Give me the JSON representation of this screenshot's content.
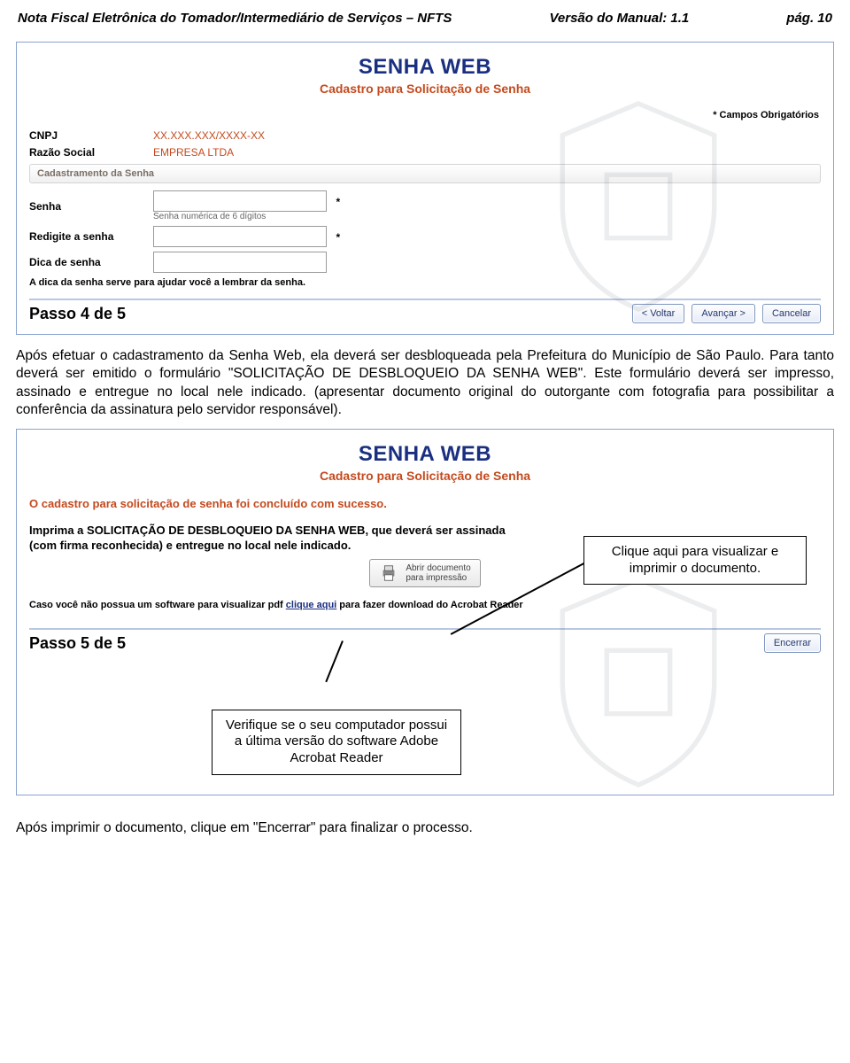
{
  "docHeader": {
    "left": "Nota Fiscal Eletrônica do Tomador/Intermediário de Serviços – NFTS",
    "center": "Versão do Manual: 1.1",
    "right": "pág. 10"
  },
  "panel1": {
    "title": "SENHA WEB",
    "subtitle": "Cadastro para Solicitação de Senha",
    "requiredNote": "* Campos Obrigatórios",
    "cnpjLabel": "CNPJ",
    "cnpjValue": "XX.XXX.XXX/XXXX-XX",
    "razaoLabel": "Razão Social",
    "razaoValue": "EMPRESA LTDA",
    "groupTitle": "Cadastramento da Senha",
    "senhaLabel": "Senha",
    "senhaHint": "Senha numérica de 6 dígitos",
    "redigiteLabel": "Redigite a senha",
    "dicaLabel": "Dica de senha",
    "dicaHelp": "A dica da senha serve para ajudar você a lembrar da senha.",
    "step": "Passo 4 de 5",
    "btnVoltar": "< Voltar",
    "btnAvancar": "Avançar >",
    "btnCancelar": "Cancelar"
  },
  "paragraph1": "Após efetuar o cadastramento da Senha Web, ela deverá ser desbloqueada pela Prefeitura do Município de São Paulo. Para tanto deverá ser emitido o formulário \"SOLICITAÇÃO DE DESBLOQUEIO DA SENHA WEB\". Este formulário deverá ser impresso, assinado e entregue no local nele indicado. (apresentar documento original do outorgante com fotografia para possibilitar a conferência da assinatura pelo servidor responsável).",
  "panel2": {
    "title": "SENHA WEB",
    "subtitle": "Cadastro para Solicitação de Senha",
    "success": "O cadastro para solicitação de senha foi concluído com sucesso.",
    "instruct": "Imprima a SOLICITAÇÃO DE DESBLOQUEIO DA SENHA WEB, que deverá ser assinada (com firma reconhecida) e entregue no local nele indicado.",
    "printLine1": "Abrir documento",
    "printLine2": "para impressão",
    "pdfNotePre": "Caso você não possua um software para visualizar pdf ",
    "pdfLink": "clique aqui",
    "pdfNotePost": " para fazer download do Acrobat Reader",
    "step": "Passo 5 de 5",
    "btnEncerrar": "Encerrar"
  },
  "callout1": "Clique aqui para visualizar e imprimir o documento.",
  "callout2": "Verifique se o seu computador possui a última versão do software Adobe Acrobat Reader",
  "footer": "Após imprimir o documento, clique em \"Encerrar\" para finalizar o processo."
}
